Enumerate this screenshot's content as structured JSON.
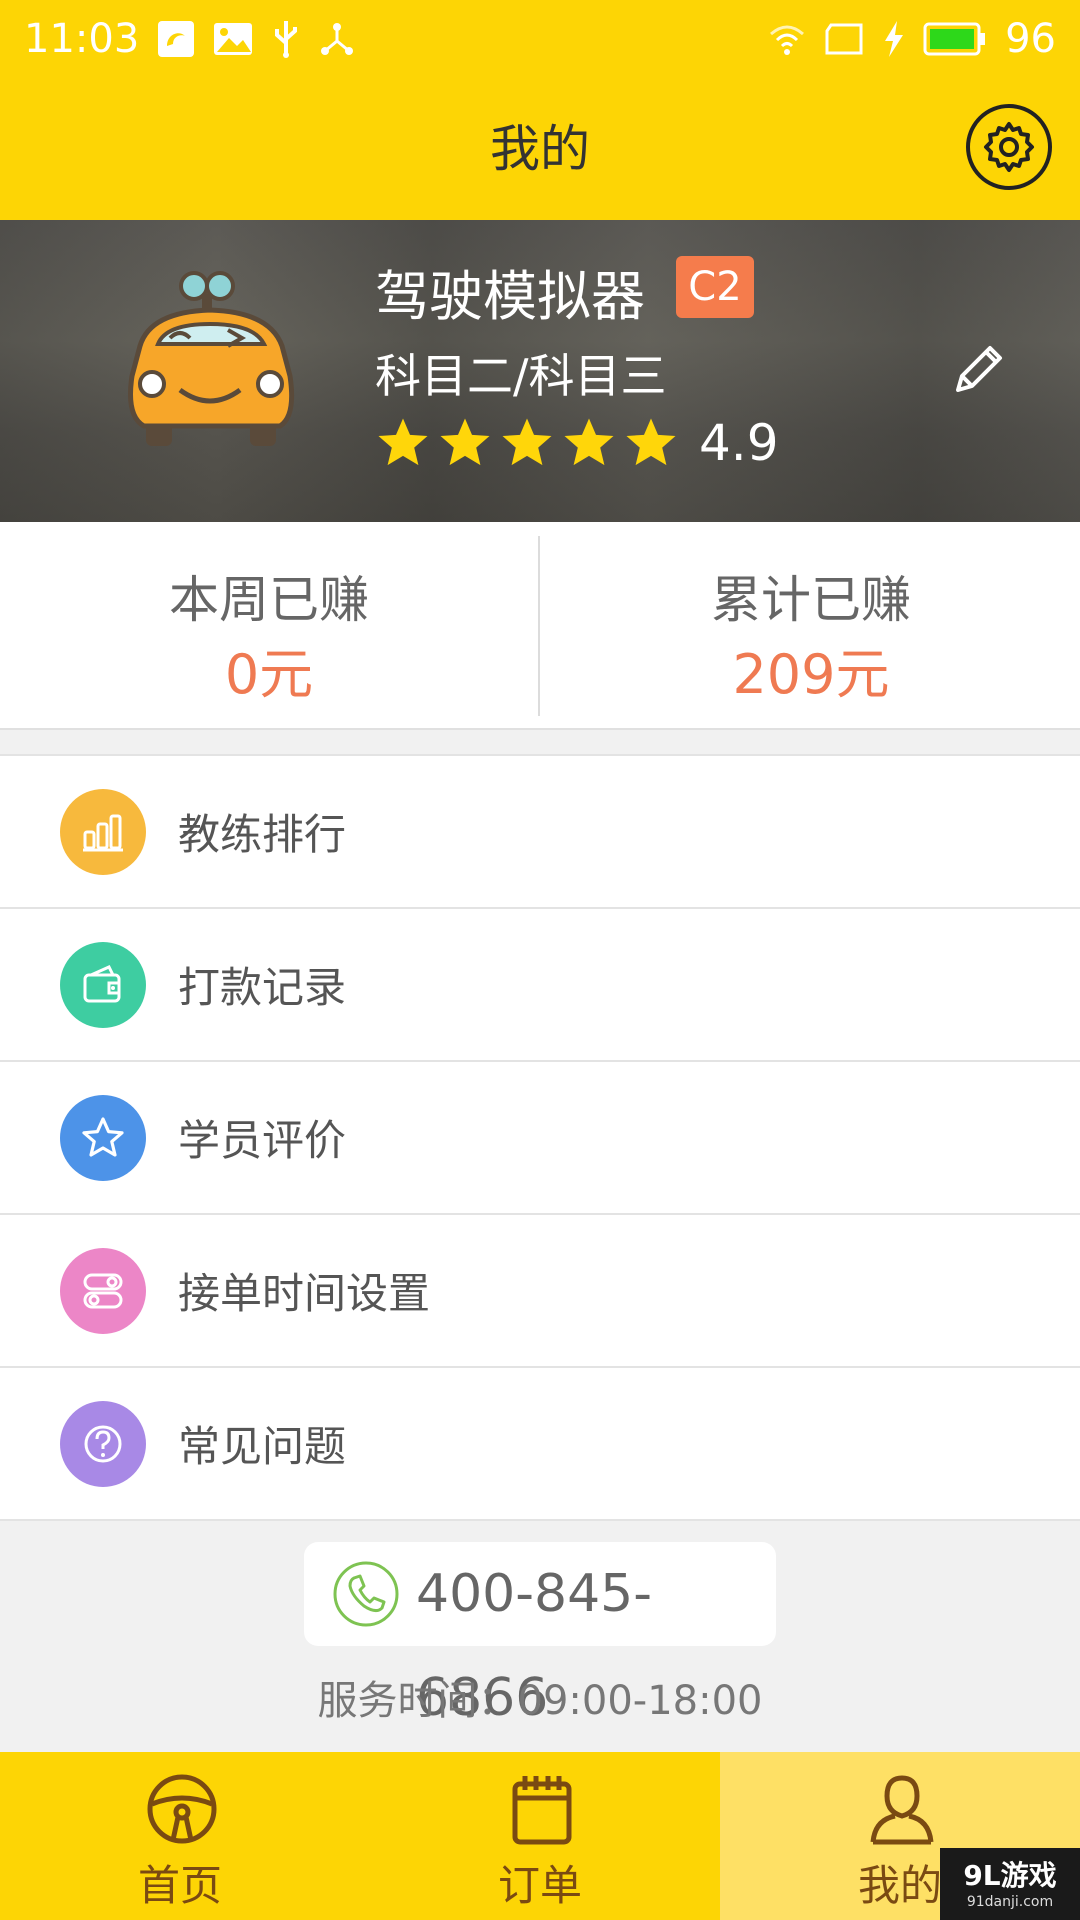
{
  "status_bar": {
    "time": "11:03",
    "battery": "96",
    "icons": [
      "uc-browser-icon",
      "image-icon",
      "usb-icon",
      "share-icon",
      "wifi-icon",
      "screen-icon",
      "charging-icon",
      "battery-icon"
    ]
  },
  "header": {
    "title": "我的",
    "settings_icon": "gear-icon"
  },
  "profile": {
    "name": "驾驶模拟器",
    "license": "C2",
    "subjects": "科目二/科目三",
    "stars": 5,
    "rating": "4.9",
    "edit_icon": "pencil-icon"
  },
  "earnings": {
    "week_label": "本周已赚",
    "week_value": "0元",
    "total_label": "累计已赚",
    "total_value": "209元"
  },
  "menu": [
    {
      "label": "教练排行",
      "icon": "ranking-bars-icon",
      "color": "#f7b93d"
    },
    {
      "label": "打款记录",
      "icon": "wallet-icon",
      "color": "#3ecda1"
    },
    {
      "label": "学员评价",
      "icon": "star-icon",
      "color": "#4d93e8"
    },
    {
      "label": "接单时间设置",
      "icon": "toggle-icon",
      "color": "#ec86c7"
    },
    {
      "label": "常见问题",
      "icon": "question-icon",
      "color": "#a889e6"
    }
  ],
  "contact": {
    "phone": "400-845-6866",
    "service_hours": "服务时间：09:00-18:00"
  },
  "bottom_nav": [
    {
      "label": "首页",
      "icon": "steering-wheel-icon",
      "active": false
    },
    {
      "label": "订单",
      "icon": "calendar-icon",
      "active": false
    },
    {
      "label": "我的",
      "icon": "person-icon",
      "active": true
    }
  ],
  "watermark": {
    "main": "9L游戏",
    "sub": "91danji.com"
  },
  "colors": {
    "brand_yellow": "#fdd505",
    "active_tab": "#fee065",
    "earnings_value": "#ef7a52",
    "license_badge": "#f57c4c"
  }
}
